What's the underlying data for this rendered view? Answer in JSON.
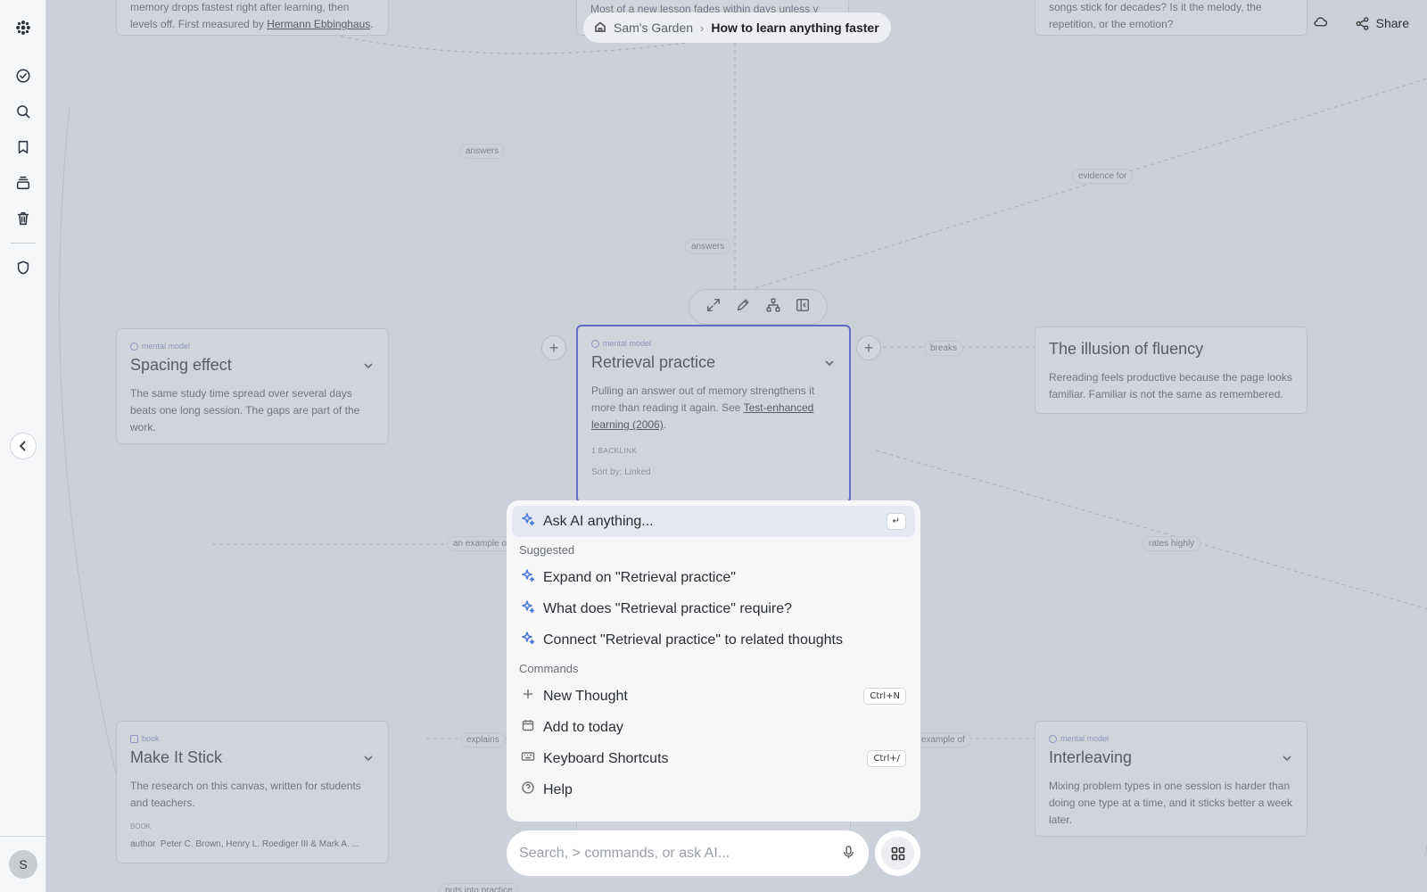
{
  "breadcrumb": {
    "root": "Sam's Garden",
    "current": "How to learn anything faster",
    "separator": "›"
  },
  "topbar": {
    "share_label": "Share",
    "cloud_icon": "cloud-icon",
    "share_icon": "share-icon"
  },
  "sidebar": {
    "items": [
      "logo-icon",
      "tasks-check-icon",
      "search-icon",
      "bookmark-icon",
      "stack-icon",
      "trash-icon",
      "shield-icon"
    ],
    "avatar_initial": "S"
  },
  "edge_labels": {
    "answers_left": "answers",
    "answers_center": "answers",
    "evidence_for": "evidence for",
    "breaks": "breaks",
    "an_example_of_left": "an example of",
    "rates_highly": "rates highly",
    "explains": "explains",
    "an_example_of_right": "an example of",
    "puts_into_practice": "puts into practice"
  },
  "cards": {
    "top_left": {
      "body_prefix": "memory drops fastest right after learning, then levels off. First measured by",
      "link": "Hermann Ebbinghaus",
      "suffix": "."
    },
    "top_center": {
      "body": "Most of a new lesson fades within days unless y"
    },
    "top_right": {
      "body": "songs stick for decades? Is it the melody, the repetition, or the emotion?"
    },
    "spacing": {
      "tag": "mental model",
      "title": "Spacing effect",
      "body": "The same study time spread over several days beats one long session. The gaps are part of the work."
    },
    "retrieval": {
      "tag": "mental model",
      "title": "Retrieval practice",
      "body": "Pulling an answer out of memory strengthens it more than reading it again. See",
      "link": "Test-enhanced learning (2006)",
      "suffix": ".",
      "backlinks": "1 BACKLINK",
      "sort_by": "Sort by: Linked"
    },
    "fluency": {
      "title": "The illusion of fluency",
      "body": "Rereading feels productive because the page looks familiar. Familiar is not the same as remembered."
    },
    "make_it_stick": {
      "tag": "book",
      "title": "Make It Stick",
      "body": "The research on this canvas, written for students and teachers.",
      "meta": "BOOK",
      "author_label": "author",
      "author": "Peter C. Brown, Henry L. Roediger III & Mark A. ..."
    },
    "interleaving": {
      "tag": "mental model",
      "title": "Interleaving",
      "body": "Mixing problem types in one session is harder than doing one type at a time, and it sticks better a week later."
    }
  },
  "palette": {
    "ask_ai": "Ask AI anything...",
    "ask_ai_key": "↵",
    "suggested_header": "Suggested",
    "suggested": [
      "Expand on \"Retrieval practice\"",
      "What does \"Retrieval practice\" require?",
      "Connect \"Retrieval practice\" to related thoughts"
    ],
    "commands_header": "Commands",
    "commands": [
      {
        "label": "New Thought",
        "shortcut": "Ctrl+N",
        "icon": "plus-icon"
      },
      {
        "label": "Add to today",
        "shortcut": "",
        "icon": "calendar-icon"
      },
      {
        "label": "Keyboard Shortcuts",
        "shortcut": "Ctrl+/",
        "icon": "keyboard-icon"
      },
      {
        "label": "Help",
        "shortcut": "",
        "icon": "help-icon"
      }
    ]
  },
  "search": {
    "placeholder": "Search, > commands, or ask AI..."
  },
  "colors": {
    "accent": "#3d4bd6",
    "ai_sparkle": "#4a78d8",
    "tag": "#8b8fd0"
  }
}
